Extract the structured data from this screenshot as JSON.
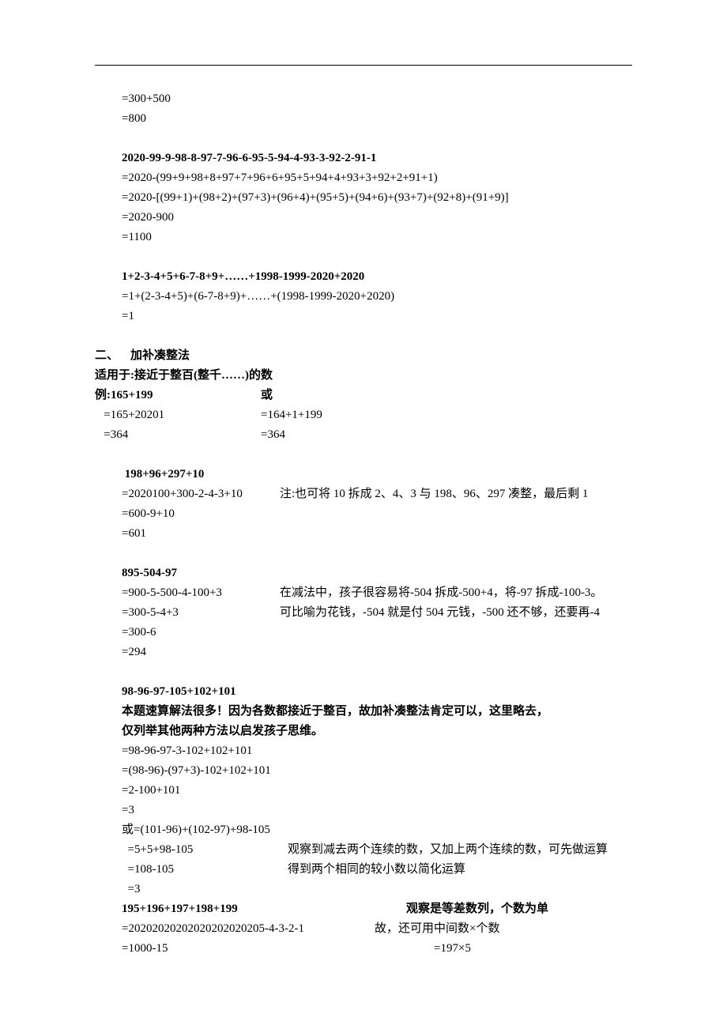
{
  "block1": {
    "l1": "=300+500",
    "l2": "=800"
  },
  "block2": {
    "title": "2020-99-9-98-8-97-7-96-6-95-5-94-4-93-3-92-2-91-1",
    "l1": "=2020-(99+9+98+8+97+7+96+6+95+5+94+4+93+3+92+2+91+1)",
    "l2": "=2020-[(99+1)+(98+2)+(97+3)+(96+4)+(95+5)+(94+6)+(93+7)+(92+8)+(91+9)]",
    "l3": "=2020-900",
    "l4": "=1100"
  },
  "block3": {
    "title": "1+2-3-4+5+6-7-8+9+……+1998-1999-2020+2020",
    "l1": "=1+(2-3-4+5)+(6-7-8+9)+……+(1998-1999-2020+2020)",
    "l2": "=1"
  },
  "sec2": {
    "heading": "二、    加补凑整法",
    "usage": "适用于:接近于整百(整千……)的数",
    "exLabelL": "例:165+199",
    "exLabelR": "或",
    "row1L": "   =165+20201",
    "row1R": "=164+1+199",
    "row2L": "   =364",
    "row2R": "=364"
  },
  "block4": {
    "title": " 198+96+297+10",
    "l1L": "=2020100+300-2-4-3+10",
    "l1R": "注:也可将 10 拆成 2、4、3 与 198、96、297 凑整，最后剩 1",
    "l2": "=600-9+10",
    "l3": "=601"
  },
  "block5": {
    "title": "895-504-97",
    "l1L": "=900-5-500-4-100+3",
    "l1R": "在减法中，孩子很容易将-504 拆成-500+4，将-97 拆成-100-3。",
    "l2L": "=300-5-4+3",
    "l2R": "可比喻为花钱，-504 就是付 504 元钱，-500 还不够，还要再-4",
    "l3": "=300-6",
    "l4": "=294"
  },
  "block6": {
    "title": "98-96-97-105+102+101",
    "note1": "本题速算解法很多！因为各数都接近于整百，故加补凑整法肯定可以，这里略去，",
    "note2": "仅列举其他两种方法以启发孩子思维。",
    "l1": "=98-96-97-3-102+102+101",
    "l2": "=(98-96)-(97+3)-102+102+101",
    "l3": "=2-100+101",
    "l4": "=3",
    "alt": "或=(101-96)+(102-97)+98-105",
    "a1L": "  =5+5+98-105",
    "a1R": "观察到减去两个连续的数，又加上两个连续的数，可先做运算",
    "a2L": "  =108-105",
    "a2R": "得到两个相同的较小数以简化运算",
    "a3": "  =3"
  },
  "block7": {
    "titleL": "195+196+197+198+199",
    "titleR": "观察是等差数列，个数为单",
    "l1L": "=20202020202020202020205-4-3-2-1",
    "l1R": "故，还可用中间数×个数",
    "l2L": "=1000-15",
    "l2R": "=197×5"
  }
}
